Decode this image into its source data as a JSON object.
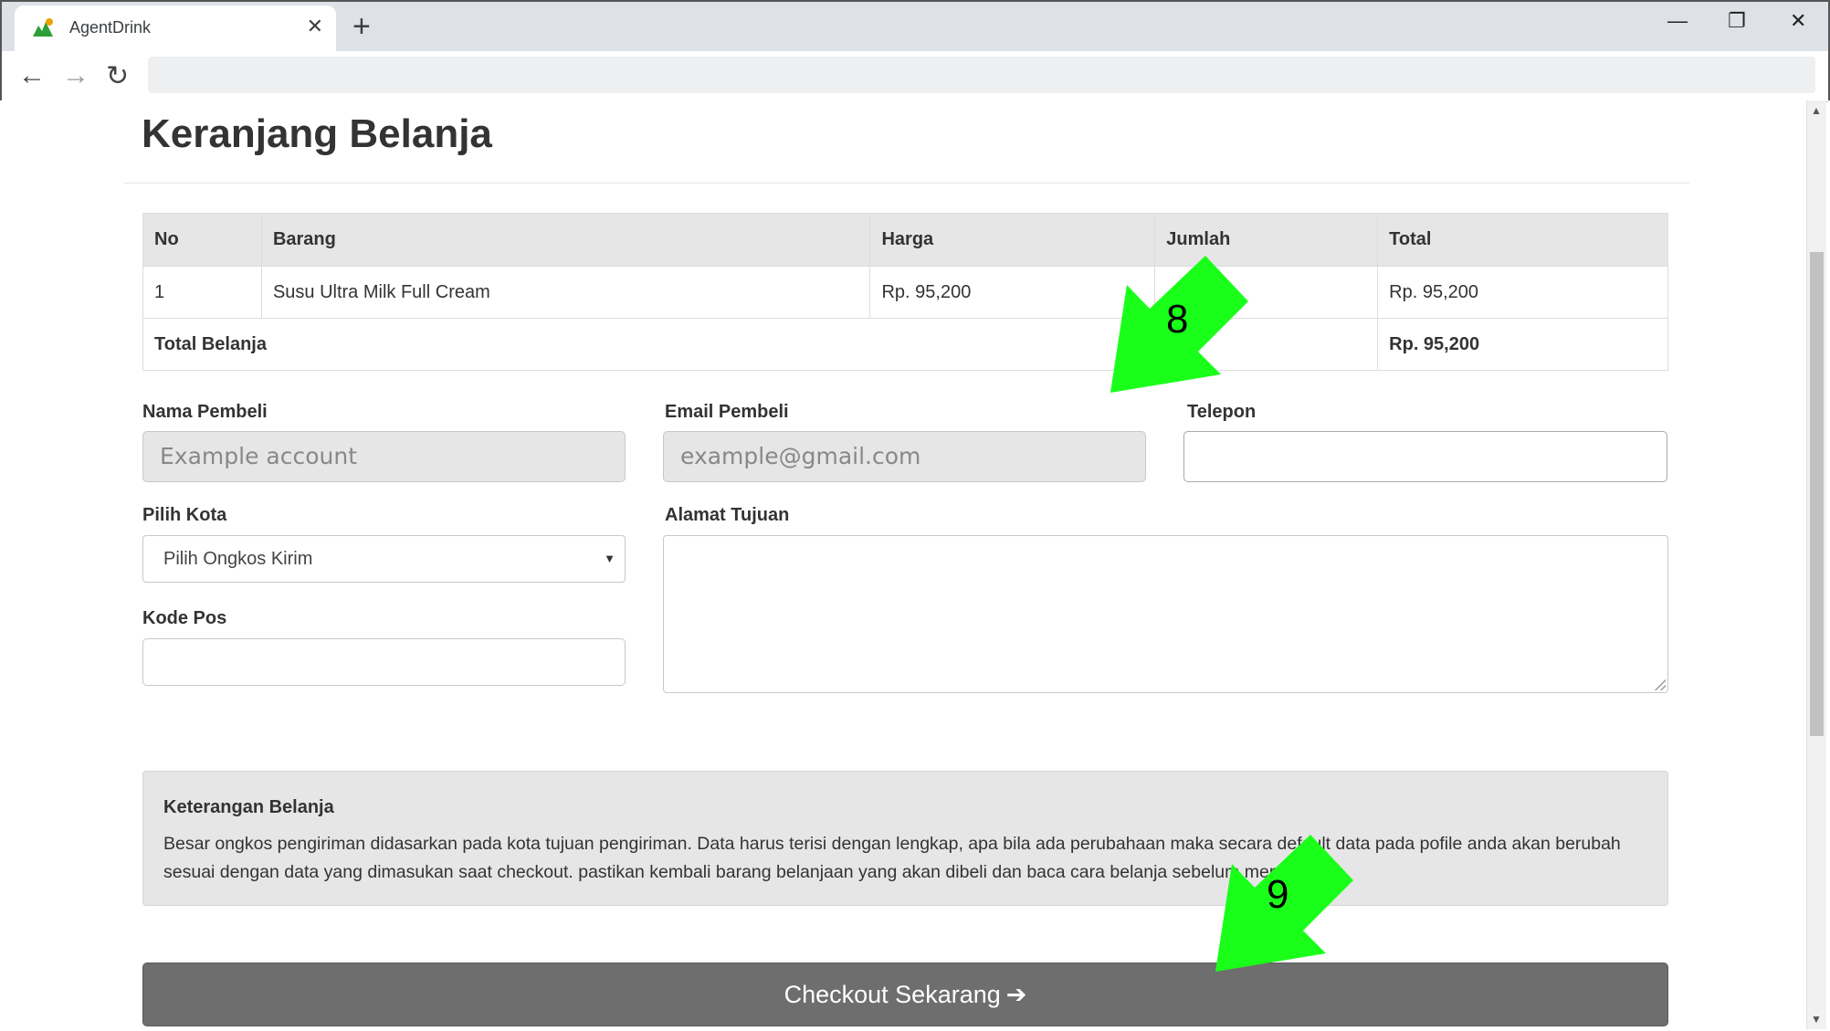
{
  "browser": {
    "tab_title": "AgentDrink",
    "tab_close": "✕",
    "new_tab": "+",
    "minimize": "—",
    "restore": "❐",
    "close": "✕",
    "back": "←",
    "forward": "→",
    "reload": "↻",
    "address": ""
  },
  "page": {
    "title": "Keranjang Belanja"
  },
  "cart": {
    "headers": [
      "No",
      "Barang",
      "Harga",
      "Jumlah",
      "Total"
    ],
    "rows": [
      {
        "no": "1",
        "item": "Susu Ultra Milk Full Cream",
        "price": "Rp. 95,200",
        "qty": "",
        "total": "Rp. 95,200"
      }
    ],
    "summary_label": "Total Belanja",
    "summary_total": "Rp. 95,200"
  },
  "form": {
    "name_label": "Nama Pembeli",
    "name_placeholder": "Example account",
    "email_label": "Email Pembeli",
    "email_placeholder": "example@gmail.com",
    "phone_label": "Telepon",
    "phone_value": "",
    "city_label": "Pilih Kota",
    "city_selected": "Pilih Ongkos Kirim",
    "address_label": "Alamat Tujuan",
    "address_value": "",
    "postal_label": "Kode Pos",
    "postal_value": ""
  },
  "info": {
    "title": "Keterangan Belanja",
    "text": "Besar ongkos pengiriman didasarkan pada kota tujuan pengiriman. Data harus terisi dengan lengkap, apa bila ada perubahaan maka secara default data pada pofile anda akan berubah sesuai dengan data yang dimasukan saat checkout. pastikan kembali barang belanjaan yang akan dibeli dan baca cara belanja sebelum membeli"
  },
  "checkout": {
    "label": "Checkout Sekarang",
    "icon": "➔"
  },
  "annotations": {
    "step8": "8",
    "step9": "9",
    "arrow_color": "#1aff1a"
  },
  "icons": {
    "favicon": "agentdrink-logo-icon",
    "select_caret": "▼",
    "scroll_up": "▲",
    "scroll_down": "▼"
  }
}
